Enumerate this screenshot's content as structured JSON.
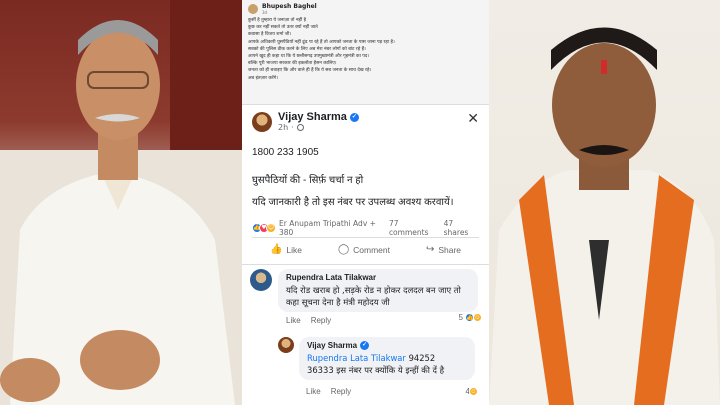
{
  "top_post": {
    "author": "Bhupesh Baghel",
    "time": "3d",
    "lines": [
      "कुर्सी है तुम्हारा ये जनाज़ा तो नहीं है",
      "कुछ कर नहीं सकते तो उतर क्यों नहीं जाते",
      "कवासा है विजय शर्मा जी।",
      "आपके अधिकारी घुसपैठियों नहीं ढूंढ पा रहे हैं तो आपको जनता के पास जाना पड़ रहा है।",
      "सबको की पुलिस ठीक करने के लिए  अब मेरा नंबर लोगों को बांट रहे हैं।",
      "आपने खुद ही कहा था कि ये छत्तीसगढ़ उपमुख्यमंत्री और गृहमंत्री का पद।",
      "बल्कि पूरी भाजपा सरकार की इकलौता हैसन कालिए।",
      "जनता को ही बचाइए कि और वाले ही हैं कि ये सब जनता के साथ देख रहे।",
      "अब इंतज़ार करेंगे।"
    ]
  },
  "main_post": {
    "author": "Vijay Sharma",
    "time": "2h",
    "phone": "1800 233 1905",
    "line1": "घुसपैठियों की - सिर्फ़ चर्चा न हो",
    "line2": "यदि जानकारी है तो इस नंबर पर उपलब्ध अवश्य  करवायें।",
    "reactors": "Er Anupam Tripathi Adv + 380",
    "comments_count": "77 comments",
    "shares_count": "47 shares",
    "like_label": "Like",
    "comment_label": "Comment",
    "share_label": "Share"
  },
  "comment1": {
    "author": "Rupendra Lata Tilakwar",
    "text": "यदि रोड खराब हो ,सड़के रोड न होकर दलदल बन जाए तो कहा सूचना देना है मंत्री महोदय जी",
    "like": "Like",
    "reply": "Reply",
    "count": "5"
  },
  "comment2": {
    "author": "Vijay Sharma",
    "tag": "Rupendra Lata Tilakwar",
    "text_a": "94252",
    "text_b": "36333 इस नंबर पर क्योंकि ये इन्हीं की दें है",
    "like": "Like",
    "reply": "Reply",
    "count": "4"
  },
  "colors": {
    "facebook_blue": "#1877f2",
    "muted": "#65676b"
  }
}
